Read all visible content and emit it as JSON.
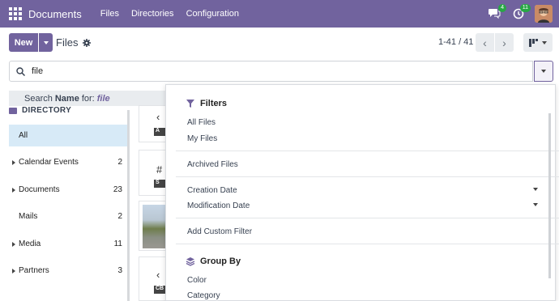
{
  "navbar": {
    "app_name": "Documents",
    "menu": [
      "Files",
      "Directories",
      "Configuration"
    ],
    "messages_badge": "4",
    "activity_badge": "11"
  },
  "control": {
    "new_label": "New",
    "breadcrumb": "Files",
    "pager_value": "1-41 / 41"
  },
  "search": {
    "query": "file",
    "suggestion_prefix": "Search",
    "suggestion_field": "Name",
    "suggestion_for": "for:",
    "suggestion_value": "file"
  },
  "sidebar": {
    "header": "DIRECTORY",
    "items": [
      {
        "label": "All",
        "count": ""
      },
      {
        "label": "Calendar Events",
        "count": "2"
      },
      {
        "label": "Documents",
        "count": "23"
      },
      {
        "label": "Mails",
        "count": "2"
      },
      {
        "label": "Media",
        "count": "11"
      },
      {
        "label": "Partners",
        "count": "3"
      }
    ]
  },
  "cards": [
    {
      "glyph": "‹",
      "tag": "A"
    },
    {
      "glyph": "#",
      "tag": "S"
    },
    {
      "glyph": "‹",
      "tag": "CB"
    }
  ],
  "filters": {
    "title": "Filters",
    "items": [
      "All Files",
      "My Files",
      "Archived Files",
      "Creation Date",
      "Modification Date",
      "Add Custom Filter"
    ]
  },
  "groupby": {
    "title": "Group By",
    "items": [
      "Color",
      "Category"
    ]
  },
  "colors": {
    "brand": "#71639e",
    "active_item": "#d7eaf7",
    "badge": "#28a745"
  }
}
